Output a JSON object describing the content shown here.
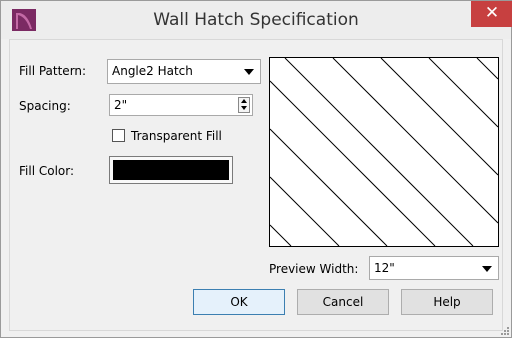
{
  "window": {
    "title": "Wall Hatch Specification",
    "close_glyph": "✕",
    "app_icon": "chief-architect-app-icon",
    "colors": {
      "titlebar_bg": "#ededed",
      "close_bg": "#c74040",
      "dialog_bg": "#f0f0f0",
      "app_icon": "#7b2a63"
    }
  },
  "form": {
    "fill_pattern": {
      "label": "Fill Pattern:",
      "value": "Angle2 Hatch"
    },
    "spacing": {
      "label": "Spacing:",
      "value": "2\""
    },
    "transparent_fill": {
      "label": "Transparent Fill",
      "checked": false
    },
    "fill_color": {
      "label": "Fill Color:",
      "value": "#000000"
    }
  },
  "preview": {
    "pattern": "diagonal-hatch-lines",
    "width_label": "Preview Width:",
    "width_value": "12\""
  },
  "buttons": {
    "ok": "OK",
    "cancel": "Cancel",
    "help": "Help"
  }
}
